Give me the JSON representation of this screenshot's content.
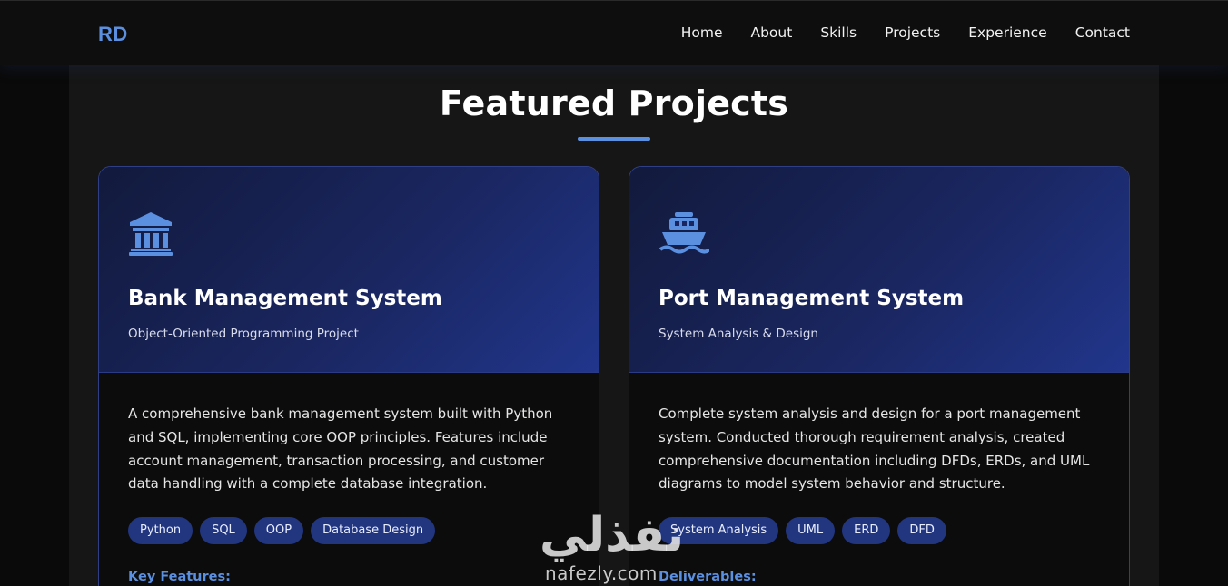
{
  "header": {
    "logo": "RD",
    "nav": [
      "Home",
      "About",
      "Skills",
      "Projects",
      "Experience",
      "Contact"
    ]
  },
  "section": {
    "title": "Featured Projects"
  },
  "projects": [
    {
      "icon": "bank-icon",
      "title": "Bank Management System",
      "subtitle": "Object-Oriented Programming Project",
      "description": "A comprehensive bank management system built with Python and SQL, implementing core OOP principles. Features include account management, transaction processing, and customer data handling with a complete database integration.",
      "tags": [
        "Python",
        "SQL",
        "OOP",
        "Database Design"
      ],
      "footer_label": "Key Features:"
    },
    {
      "icon": "ship-icon",
      "title": "Port Management System",
      "subtitle": "System Analysis & Design",
      "description": "Complete system analysis and design for a port management system. Conducted thorough requirement analysis, created comprehensive documentation including DFDs, ERDs, and UML diagrams to model system behavior and structure.",
      "tags": [
        "System Analysis",
        "UML",
        "ERD",
        "DFD"
      ],
      "footer_label": "Deliverables:"
    }
  ],
  "watermark": {
    "arabic": "نفذلي",
    "latin": "nafezly.com"
  },
  "colors": {
    "accent": "#5b8fe0",
    "tag_bg": "#22357f",
    "card_border": "#2f3f86"
  }
}
